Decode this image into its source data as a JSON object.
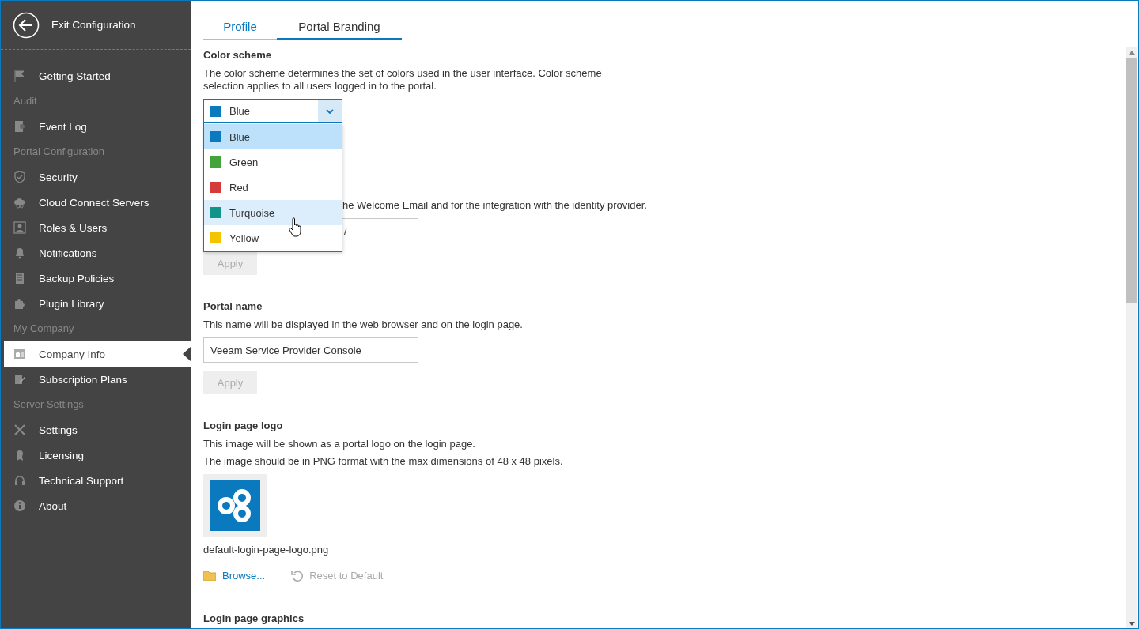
{
  "exit": {
    "label": "Exit Configuration"
  },
  "sidebar": {
    "items": [
      {
        "kind": "item",
        "label": "Getting Started",
        "selected": false
      },
      {
        "kind": "section",
        "label": "Audit"
      },
      {
        "kind": "item",
        "label": "Event Log",
        "selected": false
      },
      {
        "kind": "section",
        "label": "Portal Configuration"
      },
      {
        "kind": "item",
        "label": "Security",
        "selected": false
      },
      {
        "kind": "item",
        "label": "Cloud Connect Servers",
        "selected": false
      },
      {
        "kind": "item",
        "label": "Roles & Users",
        "selected": false
      },
      {
        "kind": "item",
        "label": "Notifications",
        "selected": false
      },
      {
        "kind": "item",
        "label": "Backup Policies",
        "selected": false
      },
      {
        "kind": "item",
        "label": "Plugin Library",
        "selected": false
      },
      {
        "kind": "section",
        "label": "My Company"
      },
      {
        "kind": "item",
        "label": "Company Info",
        "selected": true
      },
      {
        "kind": "item",
        "label": "Subscription Plans",
        "selected": false
      },
      {
        "kind": "section",
        "label": "Server Settings"
      },
      {
        "kind": "item",
        "label": "Settings",
        "selected": false
      },
      {
        "kind": "item",
        "label": "Licensing",
        "selected": false
      },
      {
        "kind": "item",
        "label": "Technical Support",
        "selected": false
      },
      {
        "kind": "item",
        "label": "About",
        "selected": false
      }
    ]
  },
  "tabs": [
    {
      "label": "Profile",
      "selected": false
    },
    {
      "label": "Portal Branding",
      "selected": true
    }
  ],
  "color_scheme": {
    "title": "Color scheme",
    "description": "The color scheme determines the set of colors used in the user interface. Color scheme selection applies to all users logged in to the portal.",
    "dropdown": {
      "value": "Blue",
      "color": "#0a79be",
      "expanded": true,
      "options": [
        {
          "label": "Blue",
          "color": "#0a79be",
          "selected": true,
          "hovered": false
        },
        {
          "label": "Green",
          "color": "#45a33c",
          "selected": false,
          "hovered": false
        },
        {
          "label": "Red",
          "color": "#d43c3c",
          "selected": false,
          "hovered": false
        },
        {
          "label": "Turquoise",
          "color": "#0f9688",
          "selected": false,
          "hovered": true
        },
        {
          "label": "Yellow",
          "color": "#f5c400",
          "selected": false,
          "hovered": false
        }
      ]
    }
  },
  "covered_section": {
    "description": "he Welcome Email and for the integration with the identity provider.",
    "field_value": "/",
    "apply": {
      "label": "Apply",
      "disabled": true
    }
  },
  "portal_name": {
    "title": "Portal name",
    "description": "This name will be displayed in the web browser and on the login page.",
    "field_value": "Veeam Service Provider Console",
    "apply": {
      "label": "Apply",
      "disabled": true
    }
  },
  "login_logo": {
    "title": "Login page logo",
    "description": [
      "This image will be shown as a portal logo on the login page.",
      "The image should be in PNG format with the max dimensions of 48 x 48 pixels."
    ],
    "filename": "default-login-page-logo.png",
    "browse": {
      "label": "Browse...",
      "disabled": false
    },
    "reset": {
      "label": "Reset to Default",
      "disabled": true
    }
  },
  "login_graphics": {
    "title": "Login page graphics"
  }
}
